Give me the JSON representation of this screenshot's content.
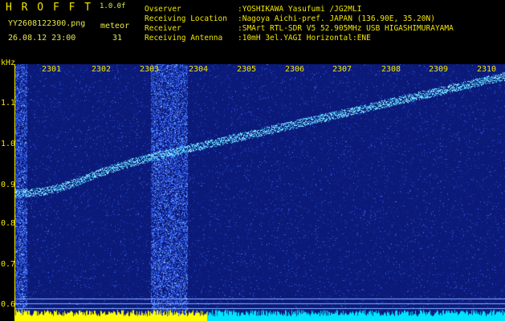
{
  "app": {
    "title": "H R O F F T",
    "version": "1.0.0f"
  },
  "status": {
    "filename": "YY2608122300.png",
    "datetime": "26.08.12 23:00",
    "meteor_label": "meteor",
    "meteor_count": "31"
  },
  "info": {
    "labels": [
      "Ovserver",
      "Receiving Location",
      "Receiver",
      "Receiving Antenna"
    ],
    "values": [
      ":YOSHIKAWA Yasufumi /JG2MLI",
      ":Nagoya Aichi-pref. JAPAN (136.90E, 35.20N)",
      ":SMArt RTL-SDR V5 52.905MHz USB HIGASHIMURAYAMA",
      ":10mH 3el.YAGI Horizontal:ENE"
    ]
  },
  "axis": {
    "y_unit": "kHz",
    "y_ticks": [
      "1.1",
      "1.0",
      "0.9",
      "0.8",
      "0.7",
      "0.6"
    ],
    "x_ticks": [
      "2301",
      "2302",
      "2303",
      "2304",
      "2305",
      "2306",
      "2307",
      "2308",
      "2309",
      "2310"
    ]
  },
  "colors": {
    "background": "#000000",
    "text": "#f2e600",
    "noise": "#1e3ad0",
    "signal": "#7fe8ff",
    "audio_low": "#ffff00",
    "audio_high": "#00e5ff"
  }
}
